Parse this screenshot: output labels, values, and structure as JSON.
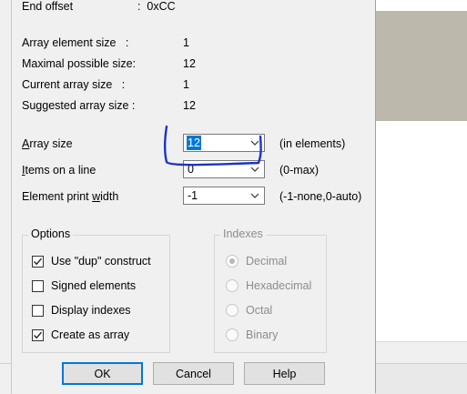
{
  "info": {
    "end_offset_label": "End offset",
    "end_offset_value": ":  0xCC",
    "array_element_size_label": "Array element size   :",
    "array_element_size_value": "1",
    "maximal_size_label": "Maximal possible size:",
    "maximal_size_value": "12",
    "current_size_label": "Current array size   :",
    "current_size_value": "1",
    "suggested_size_label": "Suggested array size :",
    "suggested_size_value": "12"
  },
  "fields": {
    "array_size": {
      "label_prefix": "A",
      "label_rest": "rray size",
      "value": "12",
      "unit": "(in elements)"
    },
    "items_on_line": {
      "label_prefix": "I",
      "label_rest": "tems on a line",
      "value": "0",
      "unit": "(0-max)"
    },
    "element_print_width": {
      "label_pre": "Element print ",
      "label_u": "w",
      "label_post": "idth",
      "value": "-1",
      "unit": "(-1-none,0-auto)"
    }
  },
  "options": {
    "title": "Options",
    "items": [
      {
        "label": "Use \"dup\" construct",
        "checked": true
      },
      {
        "label": "Signed elements",
        "checked": false
      },
      {
        "label": "Display indexes",
        "checked": false
      },
      {
        "label": "Create as array",
        "checked": true
      }
    ]
  },
  "indexes": {
    "title": "Indexes",
    "items": [
      {
        "label": "Decimal",
        "selected": true
      },
      {
        "label": "Hexadecimal",
        "selected": false
      },
      {
        "label": "Octal",
        "selected": false
      },
      {
        "label": "Binary",
        "selected": false
      }
    ]
  },
  "buttons": {
    "ok": "OK",
    "cancel": "Cancel",
    "help": "Help"
  },
  "colors": {
    "selection": "#0078d7",
    "annotation_ink": "#1a33c8",
    "default_button_border": "#0078d7"
  }
}
